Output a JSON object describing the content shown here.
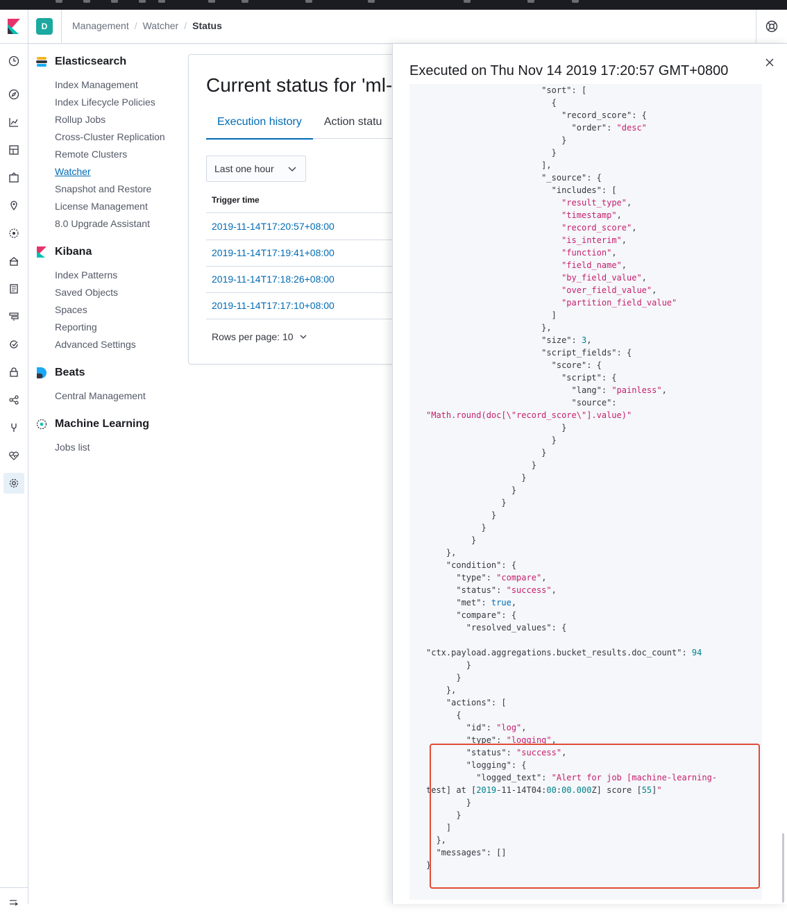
{
  "header": {
    "space_initial": "D",
    "breadcrumbs": [
      "Management",
      "Watcher",
      "Status"
    ]
  },
  "nav_icons": [
    "clock-icon",
    "compass-icon",
    "visualize-icon",
    "dashboard-icon",
    "canvas-icon",
    "maps-icon",
    "ml-icon",
    "infrastructure-icon",
    "logs-icon",
    "apm-icon",
    "uptime-icon",
    "siem-icon",
    "graph-icon",
    "dev-tools-icon",
    "monitoring-icon",
    "management-icon"
  ],
  "sidebar": {
    "groups": [
      {
        "title": "Elasticsearch",
        "items": [
          "Index Management",
          "Index Lifecycle Policies",
          "Rollup Jobs",
          "Cross-Cluster Replication",
          "Remote Clusters",
          "Watcher",
          "Snapshot and Restore",
          "License Management",
          "8.0 Upgrade Assistant"
        ]
      },
      {
        "title": "Kibana",
        "items": [
          "Index Patterns",
          "Saved Objects",
          "Spaces",
          "Reporting",
          "Advanced Settings"
        ]
      },
      {
        "title": "Beats",
        "items": [
          "Central Management"
        ]
      },
      {
        "title": "Machine Learning",
        "items": [
          "Jobs list"
        ]
      }
    ],
    "active_item": "Watcher"
  },
  "main": {
    "title": "Current status for 'ml-r",
    "tabs": [
      "Execution history",
      "Action statu"
    ],
    "time_select": "Last one hour",
    "column_header": "Trigger time",
    "rows": [
      "2019-11-14T17:20:57+08:00",
      "2019-11-14T17:19:41+08:00",
      "2019-11-14T17:18:26+08:00",
      "2019-11-14T17:17:10+08:00"
    ],
    "rows_per_page": "Rows per page: 10"
  },
  "flyout": {
    "title": "Executed on Thu Nov 14 2019 17:20:57 GMT+0800",
    "code_lines": [
      "                \"sort\": [",
      "                  {",
      "                    \"record_score\": {",
      "                      \"order\": \"desc\"",
      "                    }",
      "                  }",
      "                ],",
      "                \"_source\": {",
      "                  \"includes\": [",
      "                    \"result_type\",",
      "                    \"timestamp\",",
      "                    \"record_score\",",
      "                    \"is_interim\",",
      "                    \"function\",",
      "                    \"field_name\",",
      "                    \"by_field_value\",",
      "                    \"over_field_value\",",
      "                    \"partition_field_value\"",
      "                  ]",
      "                },",
      "                \"size\": 3,",
      "                \"script_fields\": {",
      "                  \"score\": {",
      "                    \"script\": {",
      "                      \"lang\": \"painless\",",
      "                      \"source\":",
      "\"Math.round(doc[\\\"record_score\\\"].value)\"",
      "                    }",
      "                  }",
      "                }",
      "              }",
      "            }",
      "          }",
      "        }",
      "      }",
      "    }",
      "  }",
      "},",
      "\"condition\": {",
      "  \"type\": \"compare\",",
      "  \"status\": \"success\",",
      "  \"met\": true,",
      "  \"compare\": {",
      "    \"resolved_values\": {",
      "",
      "\"ctx.payload.aggregations.bucket_results.doc_count\": 94",
      "    }",
      "  }",
      "},",
      "\"actions\": [",
      "  {",
      "    \"id\": \"log\",",
      "    \"type\": \"logging\",",
      "    \"status\": \"success\",",
      "    \"logging\": {",
      "      \"logged_text\": \"Alert for job [machine-learning-",
      "test] at [2019-11-14T04:00:00.000Z] score [55]\"",
      "    }",
      "  }",
      "]",
      "},",
      "\"messages\": []",
      "}"
    ]
  },
  "colors": {
    "link": "#006bb4",
    "string": "#c61e6e",
    "number": "#00818a",
    "highlight_box": "#e04b35"
  }
}
